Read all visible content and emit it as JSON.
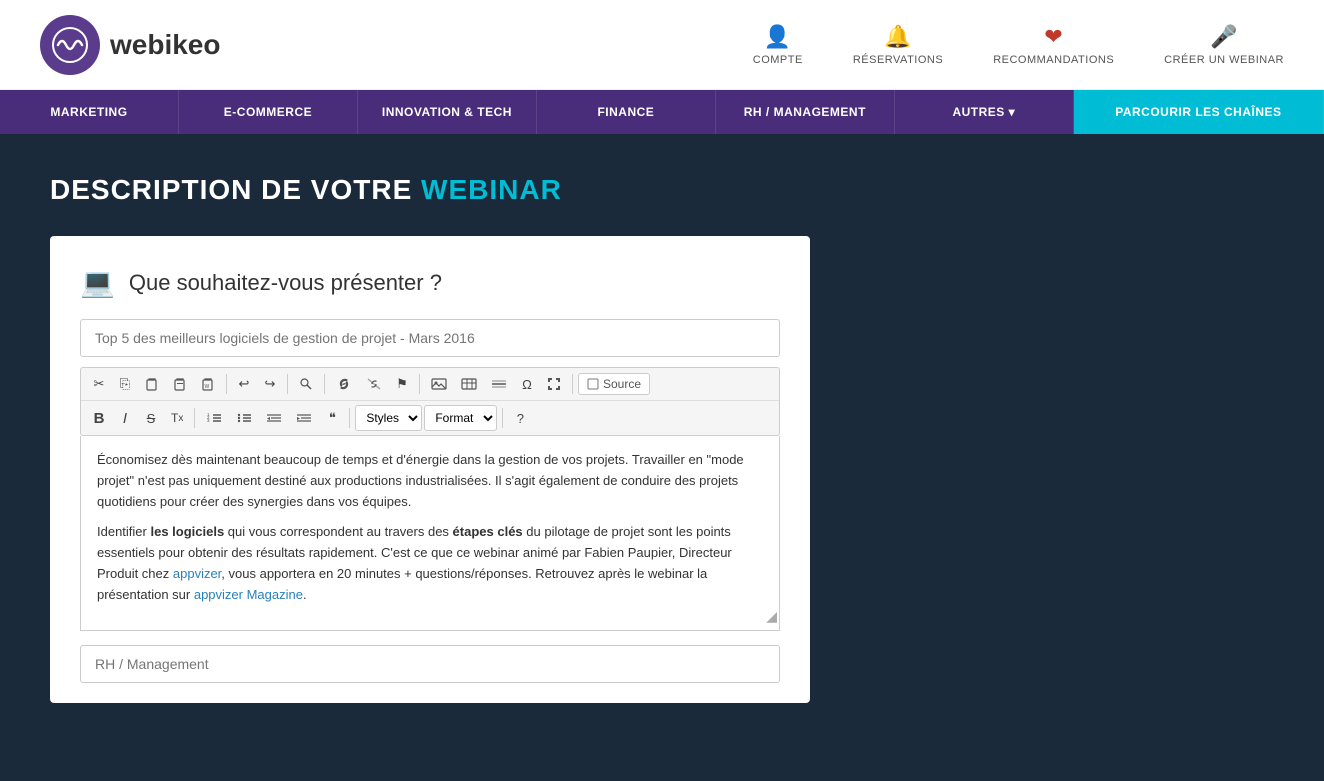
{
  "header": {
    "logo_text_normal": "webi",
    "logo_text_bold": "keo",
    "nav_items": [
      {
        "id": "compte",
        "label": "COMPTE",
        "icon": "person"
      },
      {
        "id": "reservations",
        "label": "RÉSERVATIONS",
        "icon": "bell"
      },
      {
        "id": "recommandations",
        "label": "RECOMMANDATIONS",
        "icon": "heart"
      },
      {
        "id": "creer",
        "label": "CRÉER UN WEBINAR",
        "icon": "mic"
      }
    ]
  },
  "categories": [
    {
      "id": "marketing",
      "label": "MARKETING"
    },
    {
      "id": "ecommerce",
      "label": "E-COMMERCE"
    },
    {
      "id": "innovation",
      "label": "INNOVATION & TECH"
    },
    {
      "id": "finance",
      "label": "FINANCE"
    },
    {
      "id": "rh",
      "label": "RH / MANAGEMENT"
    },
    {
      "id": "autres",
      "label": "AUTRES ▾"
    },
    {
      "id": "parcourir",
      "label": "PARCOURIR LES CHAÎNES",
      "active": true
    }
  ],
  "page": {
    "title_normal": "DESCRIPTION DE VOTRE ",
    "title_highlight": "WEBINAR"
  },
  "form": {
    "section_question": "Que souhaitez-vous présenter ?",
    "title_placeholder": "Top 5 des meilleurs logiciels de gestion de projet - Mars 2016",
    "category_placeholder": "RH / Management",
    "editor": {
      "toolbar_row1": {
        "cut": "✂",
        "copy": "⎘",
        "paste": "📋",
        "paste_text": "T",
        "paste_word": "W",
        "undo": "↩",
        "redo": "↪",
        "find": "🔍",
        "link": "🔗",
        "unlink": "🚫",
        "anchor": "⚑",
        "image": "🖼",
        "table": "⊞",
        "hr": "—",
        "special": "Ω",
        "fullscreen": "⛶",
        "source_label": "Source"
      },
      "toolbar_row2": {
        "bold": "B",
        "italic": "I",
        "strike": "S",
        "clear": "Tx",
        "ol": "1≡",
        "ul": "≡",
        "indent_less": "◁≡",
        "indent_more": "▷≡",
        "quote": "❝",
        "styles_label": "Styles",
        "format_label": "Format",
        "help": "?"
      }
    },
    "content_html": [
      "Économisez dès maintenant beaucoup de temps et d'énergie dans la gestion de vos projets. Travailler en \"mode projet\" n'est pas uniquement destiné aux productions industrialisées. Il s'agit également de conduire des projets quotidiens pour créer des synergies dans vos équipes.",
      "Identifier les logiciels qui vous correspondent au travers des étapes clés du pilotage de projet sont les points essentiels pour obtenir des résultats rapidement. C'est ce que ce webinar animé par Fabien Paupier, Directeur Produit chez appvizer, vous apportera en 20 minutes + questions/réponses. Retrouvez après le webinar la présentation sur appvizer Magazine."
    ]
  }
}
